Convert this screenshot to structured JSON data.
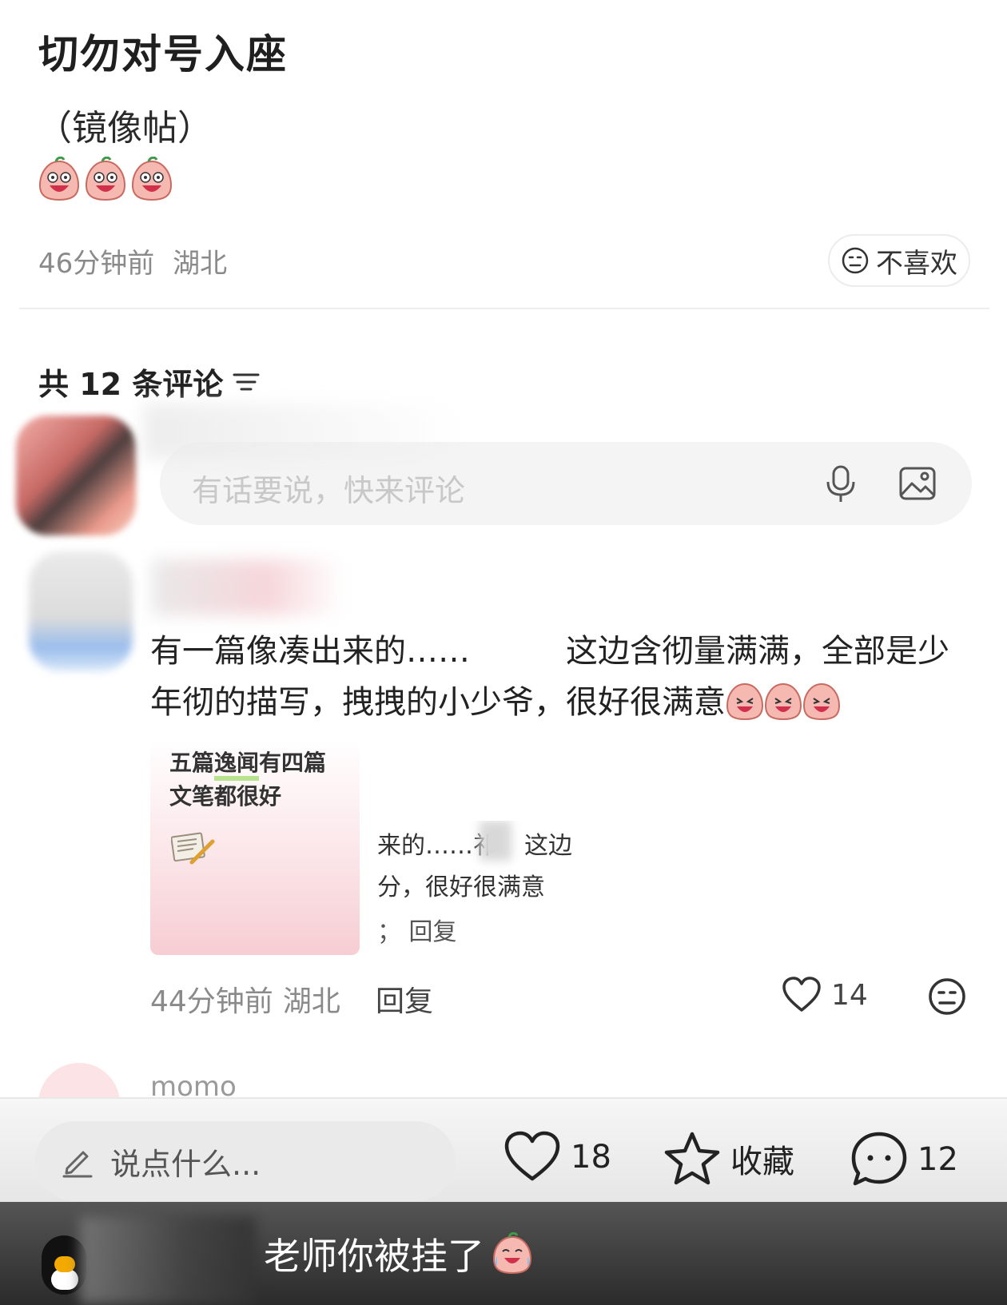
{
  "post": {
    "title": "切勿对号入座",
    "subtitle": "（镜像帖）",
    "time": "46分钟前",
    "location": "湖北",
    "dislike_label": "不喜欢"
  },
  "comments": {
    "header": "共 12 条评论",
    "input_placeholder": "有话要说，快来评论",
    "first": {
      "text_part1": "有一篇像凑出来的……",
      "text_part2": "这边含彻量满满，全部是少年彻的描写，拽拽的小少爷，很好很满意",
      "attachment": {
        "line1_a": "五篇",
        "line1_hl": "逸闻",
        "line1_b": "有四篇",
        "line2": "文笔都很好",
        "right_line1": "来的……祁",
        "right_line1_b": "这边",
        "right_line2": "分，很好很满意",
        "right_line3": "； 回复"
      },
      "time": "44分钟前",
      "location": "湖北",
      "reply_label": "回复",
      "likes": "14"
    },
    "next": {
      "name": "momo"
    }
  },
  "bottom_bar": {
    "say_placeholder": "说点什么...",
    "likes": "18",
    "favorite_label": "收藏",
    "comments": "12"
  },
  "overlay_caption": {
    "text": "老师你被挂了"
  },
  "colors": {
    "accent_pink": "#f3a3a8",
    "muted_text": "#8a8a8a"
  }
}
